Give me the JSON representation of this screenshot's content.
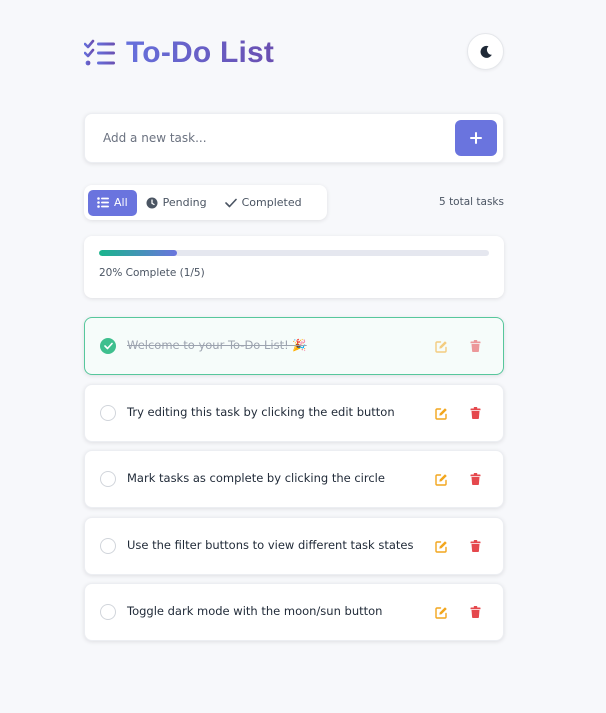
{
  "header": {
    "title": "To-Do List",
    "title_icon": "list-check-icon",
    "theme_toggle_icon": "moon-icon"
  },
  "add_task": {
    "placeholder": "Add a new task...",
    "value": "",
    "button_icon": "plus-icon"
  },
  "filters": {
    "items": [
      {
        "label": "All",
        "icon": "list-icon",
        "active": true
      },
      {
        "label": "Pending",
        "icon": "clock-icon",
        "active": false
      },
      {
        "label": "Completed",
        "icon": "check-icon",
        "active": false
      }
    ],
    "total_text": "5 total tasks"
  },
  "progress": {
    "percent": 20,
    "label": "20% Complete (1/5)"
  },
  "tasks": [
    {
      "text": "Welcome to your To-Do List! 🎉",
      "completed": true
    },
    {
      "text": "Try editing this task by clicking the edit button",
      "completed": false
    },
    {
      "text": "Mark tasks as complete by clicking the circle",
      "completed": false
    },
    {
      "text": "Use the filter buttons to view different task states",
      "completed": false
    },
    {
      "text": "Toggle dark mode with the moon/sun button",
      "completed": false
    }
  ],
  "colors": {
    "accent": "#6a74de",
    "success": "#3fbf8e",
    "edit": "#f2a61d",
    "delete": "#e5484d"
  }
}
